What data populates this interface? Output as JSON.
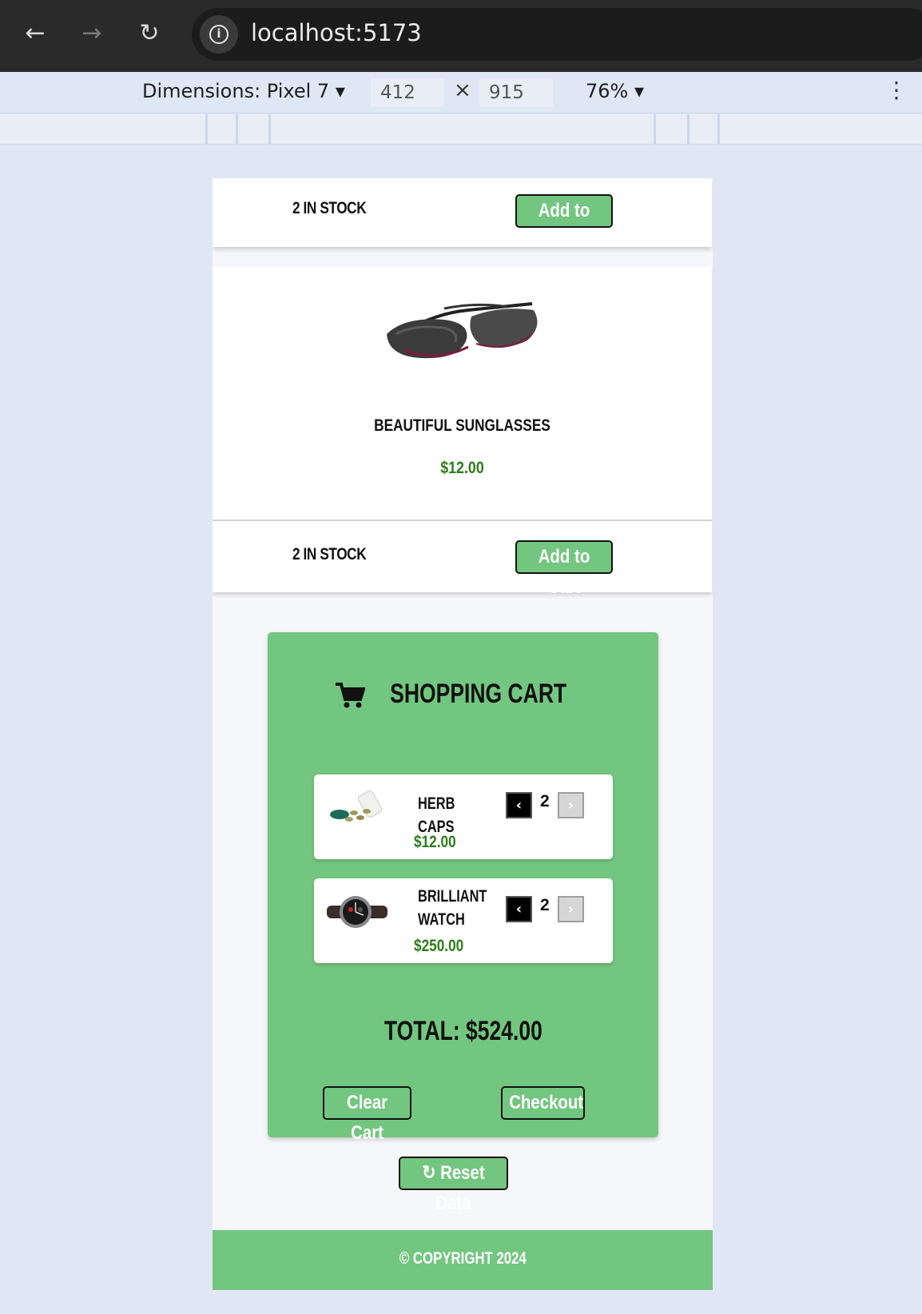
{
  "browser": {
    "url": "localhost:5173",
    "back_icon": "arrow-left-icon",
    "forward_icon": "arrow-right-icon",
    "reload_icon": "reload-icon"
  },
  "devtools": {
    "dimensions_label": "Dimensions: Pixel 7",
    "width": "412",
    "height": "915",
    "times": "×",
    "zoom": "76%"
  },
  "products": [
    {
      "stock": "2 IN STOCK",
      "add_label": "Add to Cart"
    },
    {
      "title": "BEAUTIFUL SUNGLASSES",
      "price": "$12.00",
      "stock": "2 IN STOCK",
      "add_label": "Add to Cart"
    }
  ],
  "cart": {
    "title": "SHOPPING CART",
    "items": [
      {
        "name": "HERB CAPS",
        "price": "$12.00",
        "qty": "2",
        "dec": "‹",
        "inc": "›"
      },
      {
        "name": "BRILLIANT WATCH",
        "price": "$250.00",
        "qty": "2",
        "dec": "‹",
        "inc": "›"
      }
    ],
    "total": "TOTAL: $524.00",
    "clear_label": "Clear Cart",
    "checkout_label": "Checkout"
  },
  "reset_label": "↻ Reset Data",
  "footer": {
    "copyright": "© COPYRIGHT 2024"
  },
  "colors": {
    "accent": "#73c67f",
    "price": "#2e7d19",
    "text": "#111111"
  }
}
